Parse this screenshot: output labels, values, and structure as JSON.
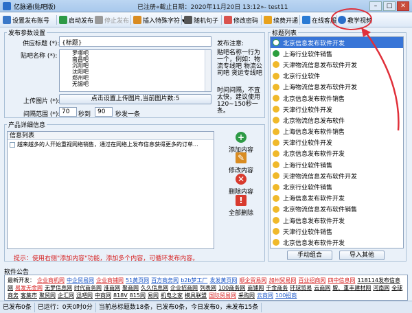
{
  "window": {
    "title": "亿脉通(贴吧版)",
    "center_text": "已注册«截止日期：2020年11月20日 13:12»- test11"
  },
  "toolbar": {
    "items": [
      {
        "label": "设置发布账号",
        "color": "#3a78c8"
      },
      {
        "label": "启动发布",
        "color": "#2e9a46"
      },
      {
        "label": "停止发布",
        "color": "#9a9a9a"
      },
      {
        "label": "插入特殊字符 ▾",
        "color": "#d98c22"
      },
      {
        "label": "随机句子",
        "color": "#555555"
      },
      {
        "label": "修改密码",
        "color": "#d9534f"
      },
      {
        "label": "续费开通",
        "color": "#e8a21c"
      },
      {
        "label": "在线客服",
        "color": "#2a7bd4"
      },
      {
        "label": "教学视频",
        "color": "#2a6ec9"
      }
    ]
  },
  "publish": {
    "group_title": "发布参数设置",
    "source_label": "供应标题 (*):",
    "source_value": "{标题}",
    "attention_label": "发布注意:",
    "tieba_label": "贴吧名称 (*):",
    "tieba_list": [
      "罗哪吧",
      "南昌吧",
      "沉阳吧",
      "沈阳吧",
      "郑州吧",
      "无锡吧",
      "石家庄口吧",
      "大同开吧",
      "湖北吧",
      "物流吧",
      "物流吧",
      "齐河吧",
      "寻车吧",
      "徐木古市吧"
    ],
    "tieba_note": "贴吧名称一行为一个，例如：物流专线吧 物流公司吧 货运专线吧",
    "upload_label": "上传图片 (*):",
    "upload_button": "点击设置上传图片,当前图片数:5",
    "interval_label": "间隔范围 (*):",
    "interval_from": "70",
    "interval_sec_label": "秒到",
    "interval_to": "90",
    "interval_tail": "秒发一条",
    "time_note": "时间间隔，不宜太快，建议使用120~150秒一条。"
  },
  "product": {
    "group_title": "产品详细信息",
    "list_header": "信息列表",
    "row": "越来越多的人开始重视网络销售，通过在网络上发布信息获得更多的订单...",
    "add_label": "添加内容",
    "edit_label": "修改内容",
    "delete_label": "删除内容",
    "delete_all_label": "全部删除",
    "tip": "提示：使用右侧\"添加内容\"功能，添加多个内容，可循环发布内容。"
  },
  "titles": {
    "group_title": "标题列表",
    "items": [
      "北京信息发布软件开发",
      "上海行业软件销售",
      "天津物流信息发布软件开发",
      "北京行业软件",
      "上海物流信息发布软件开发",
      "北京信息发布软件销售",
      "天津行业软件开发",
      "北京物流信息发布软件",
      "上海信息发布软件销售",
      "天津行业软件开发",
      "北京信息发布软件开发",
      "上海行业软件销售",
      "天津物流信息发布软件开发",
      "北京行业软件销售",
      "上海信息发布软件开发",
      "北京物流信息发布软件销售",
      "上海信息发布软件开发",
      "天津行业软件销售",
      "北京信息发布软件开发"
    ],
    "manual_button": "手动组合",
    "import_button": "导入其他"
  },
  "news": {
    "title": "软件公告",
    "prefix": "最新开发：",
    "items": [
      {
        "t": "企业商机网",
        "c": "#d62020"
      },
      {
        "t": "中企贸易网",
        "c": "#1a56c8"
      },
      {
        "t": "企业商铺网",
        "c": "#d62020"
      },
      {
        "t": "51黄页网",
        "c": "#1a56c8"
      },
      {
        "t": "百方商务网",
        "c": "#1a56c8"
      },
      {
        "t": "b2b梦工厂",
        "c": "#1a56c8"
      },
      {
        "t": "发发黄页网",
        "c": "#1a56c8"
      },
      {
        "t": "顺企贸易网",
        "c": "#d62020"
      },
      {
        "t": "加州贸易网",
        "c": "#d62020"
      },
      {
        "t": "百业招商网",
        "c": "#d62020"
      },
      {
        "t": "四中信息网",
        "c": "#d62020"
      },
      {
        "t": "118114发布信息网",
        "c": "#000000"
      },
      {
        "t": "易发无金网",
        "c": "#d62020"
      },
      {
        "t": "无罗信息网",
        "c": "#000000"
      },
      {
        "t": "时代商务网",
        "c": "#000000"
      },
      {
        "t": "淮商网",
        "c": "#000000"
      },
      {
        "t": "聚商网",
        "c": "#000000"
      },
      {
        "t": "久久信息网",
        "c": "#000000"
      },
      {
        "t": "企业招商网",
        "c": "#000000"
      },
      {
        "t": "列表网",
        "c": "#000000"
      },
      {
        "t": "100商务网",
        "c": "#000000"
      },
      {
        "t": "商铺网",
        "c": "#000000"
      },
      {
        "t": "千金商务",
        "c": "#000000"
      },
      {
        "t": "环球贸易",
        "c": "#000000"
      },
      {
        "t": "云商网",
        "c": "#000000"
      },
      {
        "t": "盟、重丰建材网",
        "c": "#000000"
      },
      {
        "t": "河南网",
        "c": "#000000"
      },
      {
        "t": "全球商务",
        "c": "#000000"
      },
      {
        "t": "客集市",
        "c": "#000000"
      },
      {
        "t": "聚贸网",
        "c": "#000000"
      },
      {
        "t": "企汇网",
        "c": "#000000"
      },
      {
        "t": "迅吧网",
        "c": "#000000"
      },
      {
        "t": "中商网",
        "c": "#000000"
      },
      {
        "t": "818V",
        "c": "#000000"
      },
      {
        "t": "815网",
        "c": "#000000"
      },
      {
        "t": "易网",
        "c": "#000000"
      },
      {
        "t": "机电之家",
        "c": "#000000"
      },
      {
        "t": "模具联盟",
        "c": "#000000"
      },
      {
        "t": "国际贸易网",
        "c": "#d62020"
      },
      {
        "t": "采购网",
        "c": "#000000"
      },
      {
        "t": "云商网",
        "c": "#1a56c8"
      },
      {
        "t": "100招商",
        "c": "#1a56c8"
      }
    ]
  },
  "status": {
    "published": "已发布0条",
    "running": "已运行：0天0时0分",
    "summary": "当前总标题数18条，已发布0条，今日发布0，未发布15条"
  }
}
